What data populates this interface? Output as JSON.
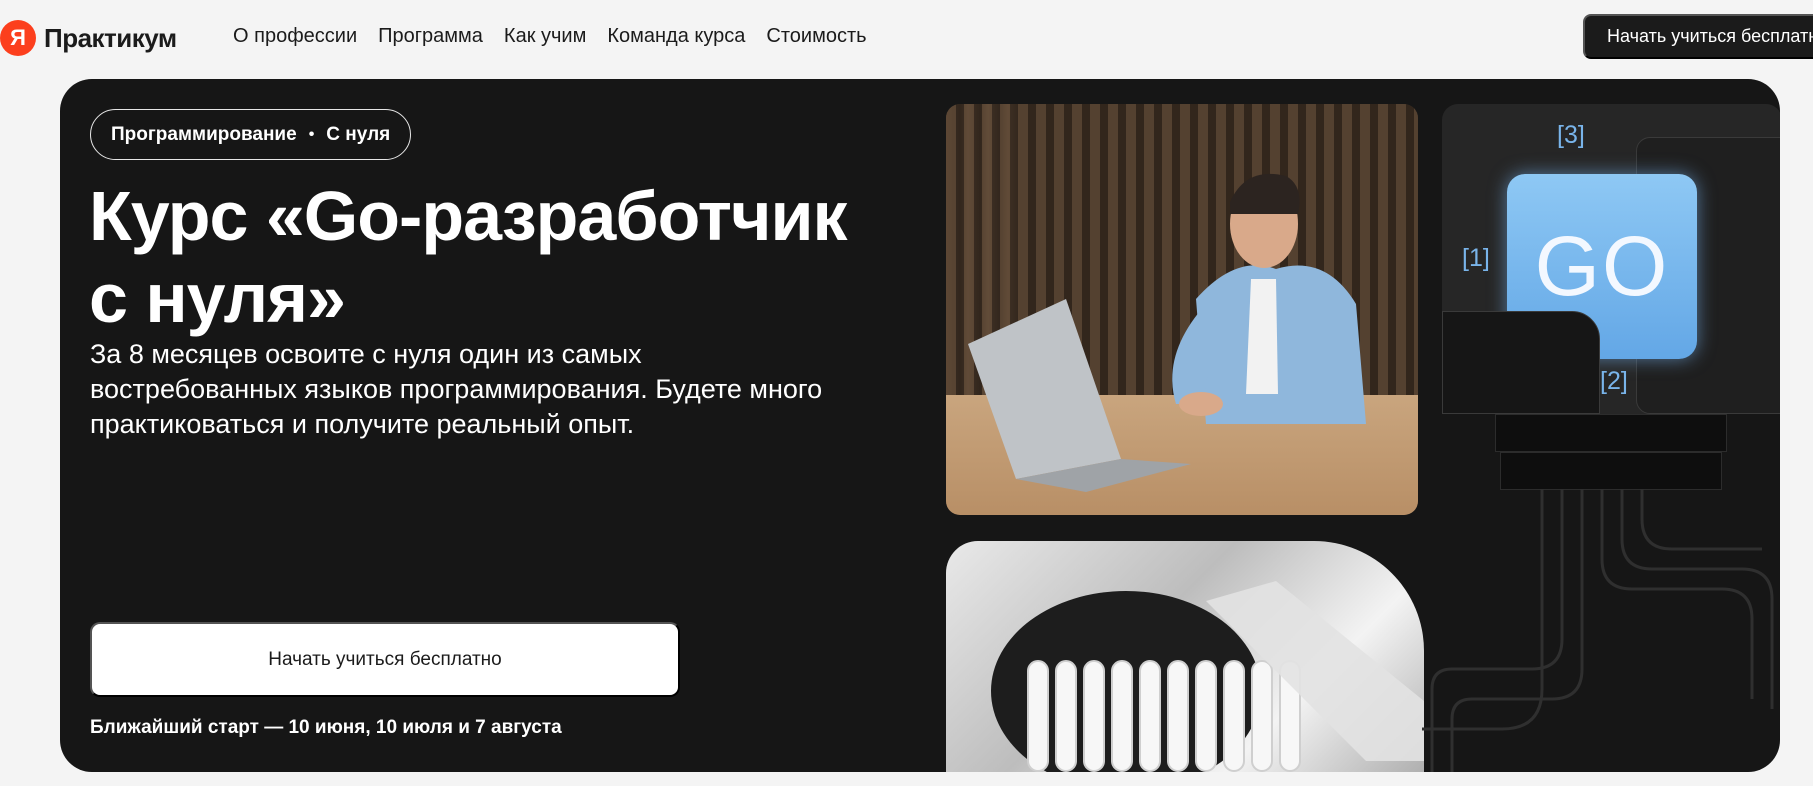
{
  "header": {
    "logo_mark": "Я",
    "logo_text": "Практикум",
    "nav": [
      {
        "label": "О профессии"
      },
      {
        "label": "Программа"
      },
      {
        "label": "Как учим"
      },
      {
        "label": "Команда курса"
      },
      {
        "label": "Стоимость"
      }
    ],
    "cta_label": "Начать учиться бесплатно"
  },
  "hero": {
    "tag": {
      "category": "Программирование",
      "separator": "•",
      "level": "С нуля"
    },
    "title": "Курс «Go-разработчик с нуля»",
    "description": "За 8 месяцев освоите с нуля один из самых востребованных языков программирования. Будете много практиковаться и получите реальный опыт.",
    "cta_label": "Начать учиться бесплатно",
    "start_info": "Ближайший старт — 10 июня, 10 июля и 7 августа",
    "illustration": {
      "key_label": "GO",
      "brackets": [
        "[1]",
        "[2]",
        "[3]"
      ],
      "key_color": "#6aaee9"
    }
  },
  "colors": {
    "brand": "#fc3f1d",
    "hero_bg": "#161616",
    "page_bg": "#f4f4f4"
  }
}
